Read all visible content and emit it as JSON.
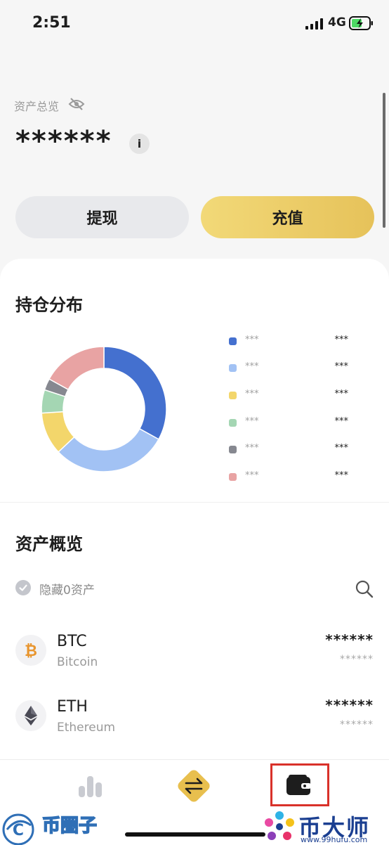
{
  "status_bar": {
    "time": "2:51",
    "network": "4G"
  },
  "header": {
    "overview_label": "资产总览",
    "balance": "******",
    "info_label": "i",
    "withdraw_label": "提现",
    "deposit_label": "充值"
  },
  "holdings": {
    "title": "持仓分布",
    "chart_data": {
      "type": "pie",
      "values": [
        33,
        30,
        11,
        6,
        3,
        17
      ],
      "colors": [
        "#4470cf",
        "#a2c2f4",
        "#f3d66b",
        "#a4d6b3",
        "#868890",
        "#e8a3a3"
      ]
    },
    "legend": [
      {
        "name": "***",
        "value": "***",
        "color": "#4470cf"
      },
      {
        "name": "***",
        "value": "***",
        "color": "#a2c2f4"
      },
      {
        "name": "***",
        "value": "***",
        "color": "#f3d66b"
      },
      {
        "name": "***",
        "value": "***",
        "color": "#a4d6b3"
      },
      {
        "name": "***",
        "value": "***",
        "color": "#868890"
      },
      {
        "name": "***",
        "value": "***",
        "color": "#e8a3a3"
      }
    ]
  },
  "assets": {
    "title": "资产概览",
    "hide_zero_label": "隐藏0资产",
    "list": [
      {
        "symbol": "BTC",
        "name": "Bitcoin",
        "amount": "******",
        "value": "******",
        "icon": "bitcoin-icon"
      },
      {
        "symbol": "ETH",
        "name": "Ethereum",
        "amount": "******",
        "value": "******",
        "icon": "ethereum-icon"
      }
    ]
  },
  "nav": {
    "items": [
      "markets-icon",
      "trade-icon",
      "wallet-icon"
    ]
  },
  "watermarks": {
    "left": "币圈子",
    "right": "币大师",
    "right_url": "www.99hufu.com"
  }
}
